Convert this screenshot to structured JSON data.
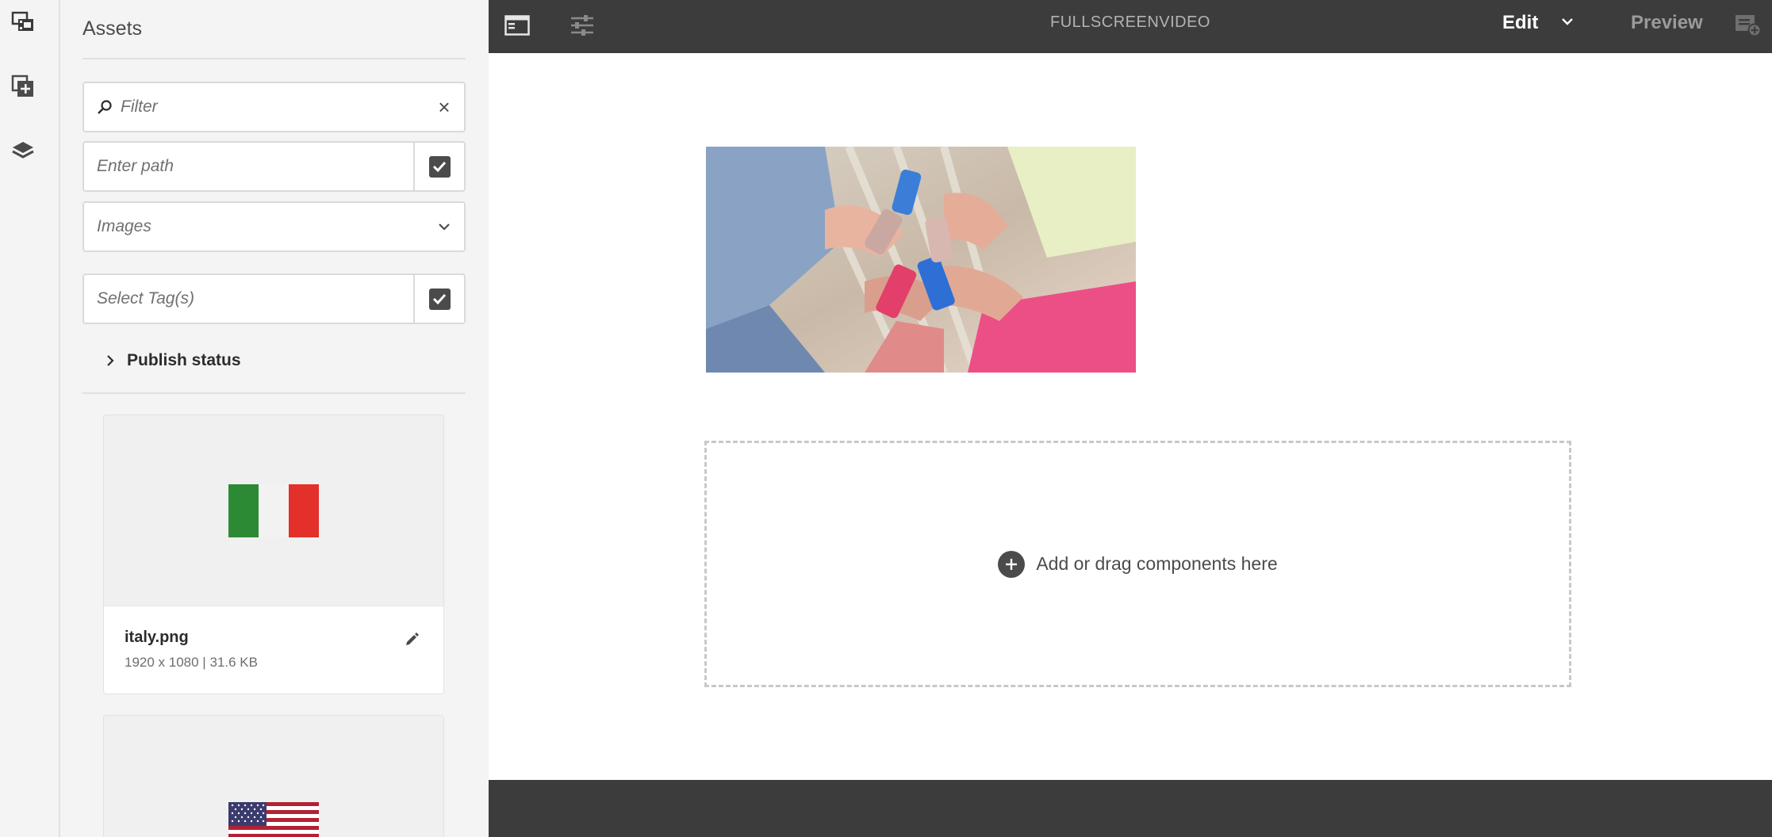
{
  "rail": {
    "items": [
      {
        "icon": "asset-finder-icon"
      },
      {
        "icon": "components-icon"
      },
      {
        "icon": "content-tree-icon"
      }
    ]
  },
  "assets_panel": {
    "title": "Assets",
    "filter_placeholder": "Filter",
    "path_placeholder": "Enter path",
    "type_select_value": "Images",
    "tags_placeholder": "Select Tag(s)",
    "publish_status_label": "Publish status",
    "cards": [
      {
        "name": "italy.png",
        "meta": "1920 x 1080 | 31.6 KB"
      },
      {
        "name": "",
        "meta": ""
      }
    ]
  },
  "topbar": {
    "page_title": "FULLSCREENVIDEO",
    "mode_label": "Edit",
    "preview_label": "Preview"
  },
  "canvas": {
    "dropzone_label": "Add or drag components here"
  },
  "colors": {
    "topbar_bg": "#3c3c3c",
    "panel_bg": "#f4f4f4",
    "accent_dark": "#4b4b4b"
  }
}
